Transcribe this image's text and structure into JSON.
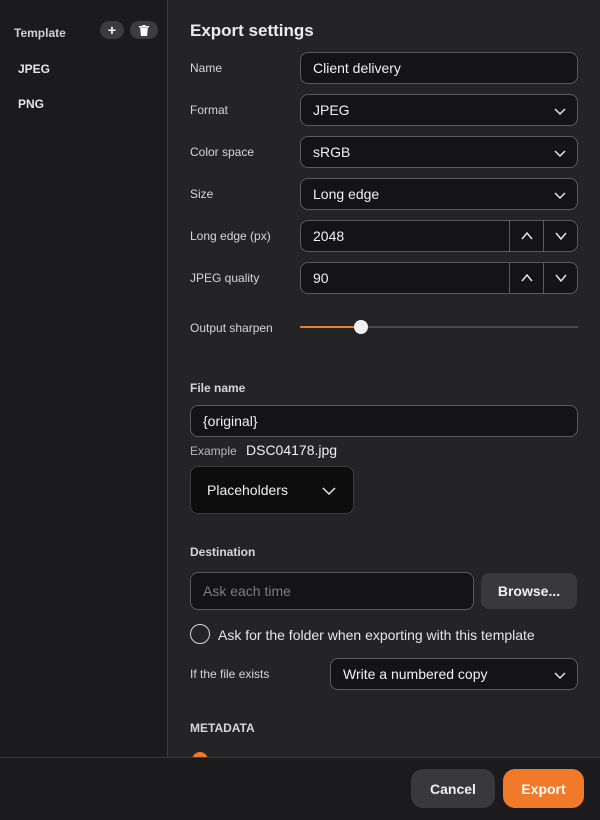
{
  "sidebar": {
    "heading": "Template",
    "add_symbol": "+",
    "items": [
      {
        "label": "JPEG"
      },
      {
        "label": "PNG"
      }
    ]
  },
  "main": {
    "title": "Export settings",
    "name": {
      "label": "Name",
      "value": "Client delivery"
    },
    "format": {
      "label": "Format",
      "value": "JPEG"
    },
    "color_space": {
      "label": "Color space",
      "value": "sRGB"
    },
    "size": {
      "label": "Size",
      "value": "Long edge"
    },
    "long_edge": {
      "label": "Long edge (px)",
      "value": "2048"
    },
    "jpeg_quality": {
      "label": "JPEG quality",
      "value": "90"
    },
    "output_sharpen": {
      "label": "Output sharpen",
      "level": 0.22
    }
  },
  "file_name": {
    "heading": "File name",
    "value": "{original}",
    "example_label": "Example",
    "example_value": "DSC04178.jpg",
    "placeholders_label": "Placeholders"
  },
  "destination": {
    "heading": "Destination",
    "placeholder": "Ask each time",
    "browse_label": "Browse...",
    "ask_folder_label": "Ask for the folder when exporting with this template",
    "if_exists_label": "If the file exists",
    "if_exists_value": "Write a numbered copy"
  },
  "metadata": {
    "heading": "METADATA"
  },
  "footer": {
    "cancel_label": "Cancel",
    "export_label": "Export"
  },
  "colors": {
    "accent": "#f07a2a",
    "background": "#242427",
    "sidebar": "#1b1b1d"
  },
  "icons": {
    "add": "plus-icon",
    "delete": "trash-icon",
    "dropdown": "chevron-down-icon",
    "increment": "chevron-up-icon",
    "decrement": "chevron-down-icon"
  }
}
